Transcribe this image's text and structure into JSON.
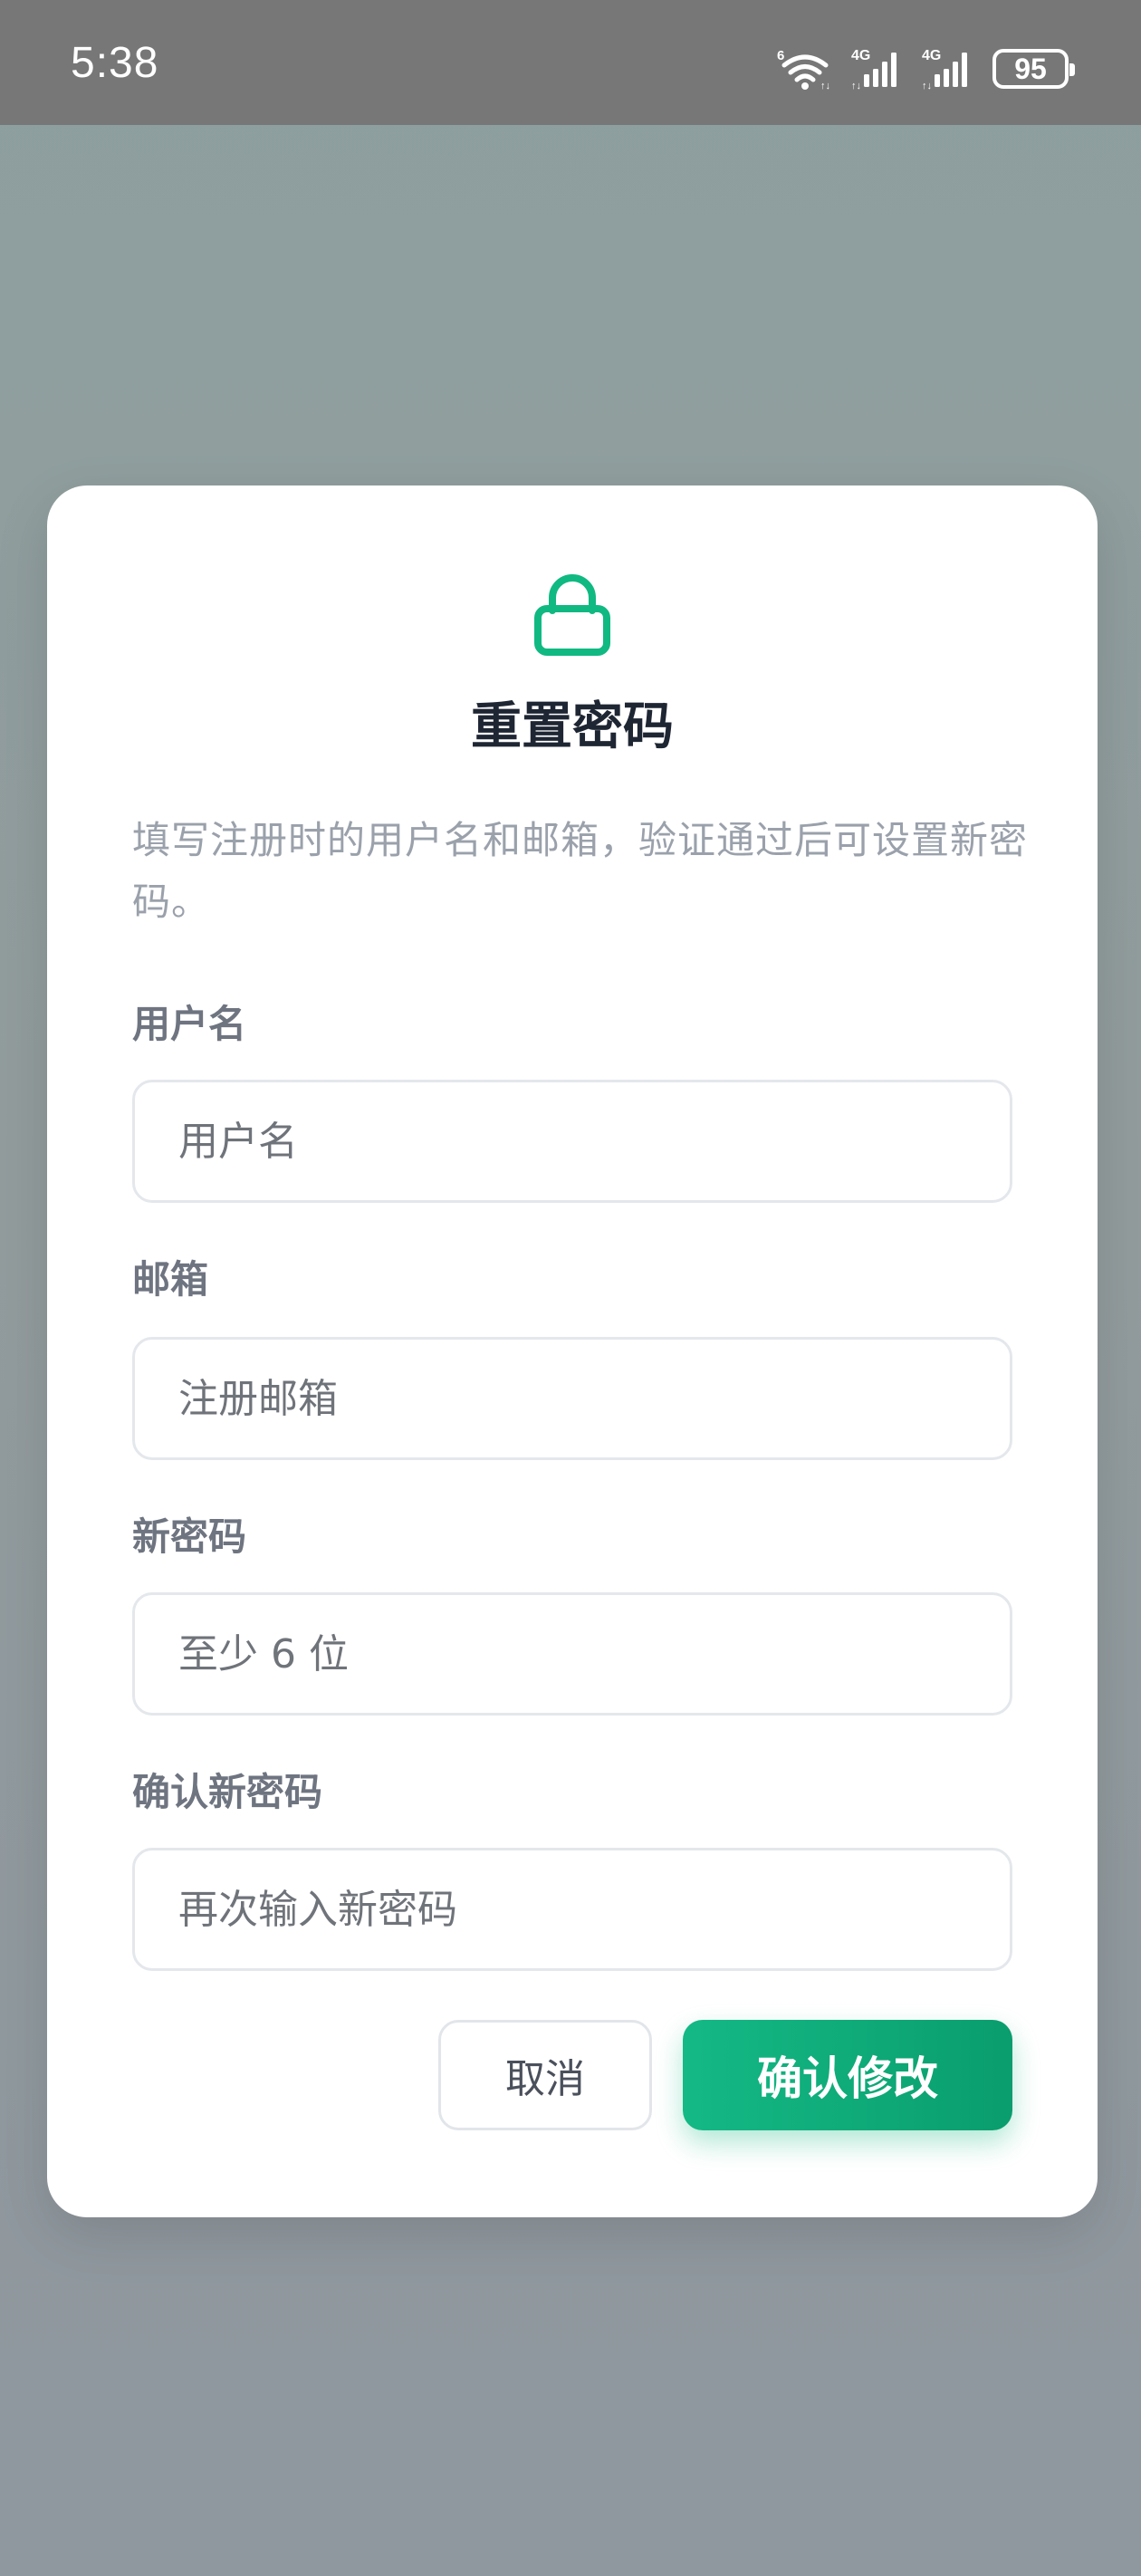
{
  "status_bar": {
    "time": "5:38",
    "wifi_badge": "6",
    "network_1": "4G",
    "network_2": "4G",
    "battery": "95",
    "icons": [
      "wifi-6-icon",
      "signal-4g-icon",
      "signal-4g-icon",
      "battery-icon"
    ]
  },
  "dialog": {
    "icon": "lock-icon",
    "accent_color": "#10b981",
    "title": "重置密码",
    "description": "填写注册时的用户名和邮箱，验证通过后可设置新密码。",
    "fields": [
      {
        "label": "用户名",
        "placeholder": "用户名",
        "value": ""
      },
      {
        "label": "邮箱",
        "placeholder": "注册邮箱",
        "value": ""
      },
      {
        "label": "新密码",
        "placeholder": "至少 6 位",
        "value": ""
      },
      {
        "label": "确认新密码",
        "placeholder": "再次输入新密码",
        "value": ""
      }
    ],
    "cancel_label": "取消",
    "confirm_label": "确认修改"
  }
}
